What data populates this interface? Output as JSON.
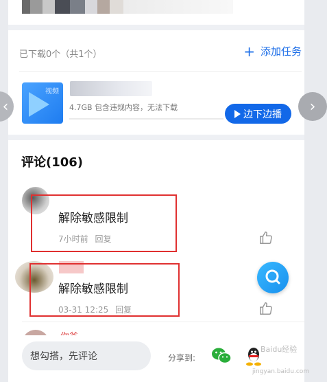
{
  "download": {
    "status": "已下载0个（共1个）",
    "add_task": "添加任务"
  },
  "file": {
    "tag": "视频",
    "meta": "4.7GB  包含违规内容，无法下载",
    "play_label": "边下边播"
  },
  "comments": {
    "title": "评论(106)",
    "items": [
      {
        "text": "解除敏感限制",
        "time": "7小时前",
        "reply": "回复"
      },
      {
        "text": "解除敏感限制",
        "time": "03-31 12:25",
        "reply": "回复"
      }
    ],
    "third_name": "你爸"
  },
  "bottom": {
    "placeholder": "想勾搭，先评论",
    "share_label": "分享到:"
  },
  "watermark": "Baidu经验",
  "watermark_sub": "jingyan.baidu.com",
  "colors": {
    "accent": "#1268e8",
    "highlight": "#e03030",
    "fab": "#1990ee"
  },
  "icons": [
    "plus-icon",
    "chevron-left-icon",
    "chevron-right-icon",
    "play-icon",
    "like-icon",
    "search-icon",
    "wechat-icon",
    "qq-icon"
  ]
}
